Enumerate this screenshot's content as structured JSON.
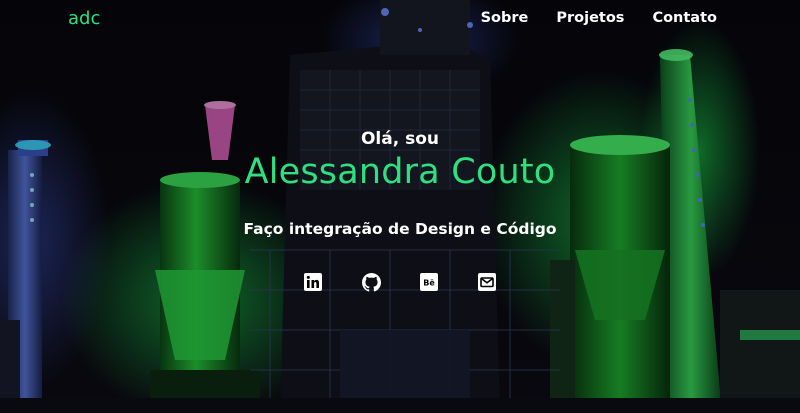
{
  "nav": {
    "brand": "adc",
    "links": [
      "Sobre",
      "Projetos",
      "Contato"
    ]
  },
  "hero": {
    "greeting": "Olá, sou",
    "name": "Alessandra Couto",
    "tagline": "Faço integração de Design e Código"
  },
  "social": [
    {
      "icon": "linkedin-icon",
      "name": "LinkedIn"
    },
    {
      "icon": "github-icon",
      "name": "GitHub"
    },
    {
      "icon": "behance-icon",
      "name": "Behance"
    },
    {
      "icon": "email-icon",
      "name": "Email"
    }
  ],
  "colors": {
    "accent": "#2ee07f",
    "text": "#ffffff",
    "background": "#05050a"
  }
}
